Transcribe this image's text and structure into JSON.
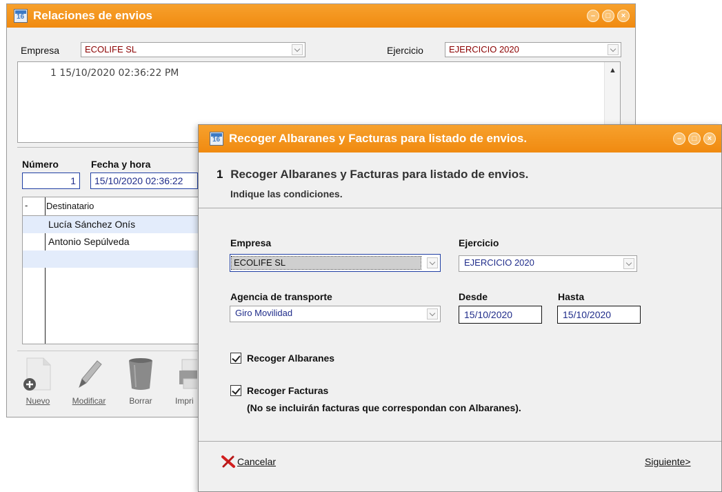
{
  "main_window": {
    "title": "Relaciones de envios",
    "window_icon_text": "16",
    "empresa_label": "Empresa",
    "empresa_value": "ECOLIFE SL",
    "ejercicio_label": "Ejercicio",
    "ejercicio_value": "EJERCICIO 2020",
    "memo_text": "1 15/10/2020 02:36:22 PM",
    "numero_label": "Número",
    "numero_value": "1",
    "fecha_label": "Fecha y hora",
    "fecha_value": "15/10/2020 02:36:22",
    "grid": {
      "header_marker": "-",
      "column_destinatario": "Destinatario",
      "rows": [
        "Lucía Sánchez Onís",
        "Antonio Sepúlveda",
        ""
      ]
    },
    "toolbar": {
      "nuevo": "Nuevo",
      "modificar": "Modificar",
      "borrar": "Borrar",
      "imprimir": "Impri"
    }
  },
  "dialog": {
    "title": "Recoger Albaranes y Facturas para listado de envios.",
    "window_icon_text": "16",
    "step_number": "1",
    "heading": "Recoger Albaranes y Facturas para listado de envios.",
    "subheading": "Indique las condiciones.",
    "empresa_label": "Empresa",
    "empresa_value": "ECOLIFE SL",
    "ejercicio_label": "Ejercicio",
    "ejercicio_value": "EJERCICIO 2020",
    "agencia_label": "Agencia de transporte",
    "agencia_value": "Giro Movilidad",
    "desde_label": "Desde",
    "desde_value": "15/10/2020",
    "hasta_label": "Hasta",
    "hasta_value": "15/10/2020",
    "recoger_albaranes_label": "Recoger Albaranes",
    "recoger_albaranes_checked": true,
    "recoger_facturas_label": "Recoger Facturas",
    "recoger_facturas_checked": true,
    "note": "(No se incluirán facturas que correspondan con Albaranes).",
    "cancel_label": "Cancelar",
    "next_label": "Siguiente>"
  },
  "colors": {
    "titlebar": "#f08a10",
    "field_text_blue": "#1f2c8a",
    "field_text_red": "#8b0000",
    "selected_row": "#e3ecfb"
  }
}
